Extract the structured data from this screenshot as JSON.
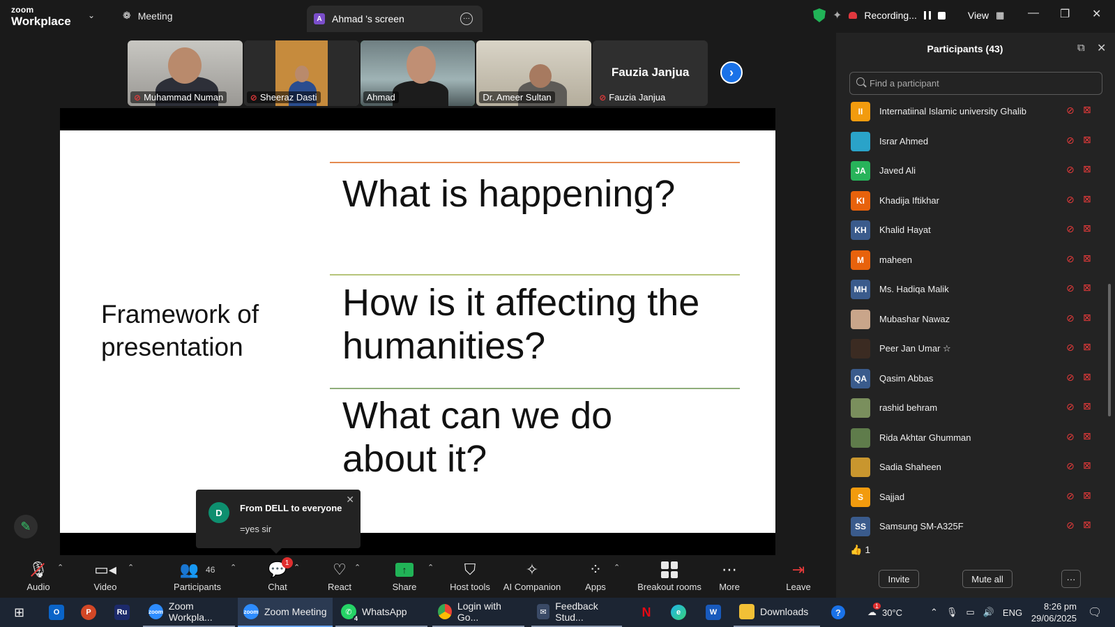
{
  "window": {
    "brand_top": "zoom",
    "brand_bottom": "Workplace",
    "meeting_tab": "Meeting",
    "screen_tab": "Ahmad 's screen",
    "screen_tab_avatar": "A",
    "recording_label": "Recording...",
    "view_label": "View"
  },
  "gallery": [
    {
      "name": "Muhammad Numan",
      "muted": true,
      "active": false
    },
    {
      "name": "Sheeraz Dasti",
      "muted": true,
      "active": false
    },
    {
      "name": "Ahmad",
      "muted": false,
      "active": true
    },
    {
      "name": "Dr. Ameer Sultan",
      "muted": false,
      "active": false
    },
    {
      "name": "Fauzia Janjua",
      "muted": true,
      "active": false,
      "big_label": "Fauzia Janjua"
    }
  ],
  "slide": {
    "left_title_line1": "Framework of",
    "left_title_line2": "presentation",
    "q1": "What is happening?",
    "q2_line1": "How is it affecting the",
    "q2_line2": "humanities?",
    "q3_line1": "What can we do",
    "q3_line2": "about it?",
    "line_colors": [
      "#e48a4f",
      "#b6c47a",
      "#8fae7a"
    ]
  },
  "chat_toast": {
    "avatar": "D",
    "from": "From DELL to everyone",
    "message": "=yes sir"
  },
  "toolbar": {
    "audio": "Audio",
    "video": "Video",
    "participants": "Participants",
    "participants_count": "46",
    "chat": "Chat",
    "chat_badge": "1",
    "react": "React",
    "share": "Share",
    "host_tools": "Host tools",
    "ai_companion": "AI Companion",
    "apps": "Apps",
    "breakout_rooms": "Breakout rooms",
    "more": "More",
    "leave": "Leave"
  },
  "participants_panel": {
    "title": "Participants (43)",
    "search_placeholder": "Find a participant",
    "items": [
      {
        "name": "Internatiinal Islamic university Ghalib",
        "initials": "II",
        "color": "#f29b0e"
      },
      {
        "name": "Israr Ahmed",
        "initials": "",
        "color": "#2aa3c9"
      },
      {
        "name": "Javed Ali",
        "initials": "JA",
        "color": "#27b35a"
      },
      {
        "name": "Khadija Iftikhar",
        "initials": "KI",
        "color": "#e8620c"
      },
      {
        "name": "Khalid Hayat",
        "initials": "KH",
        "color": "#3a5b8c"
      },
      {
        "name": "maheen",
        "initials": "M",
        "color": "#e8620c"
      },
      {
        "name": "Ms. Hadiqa Malik",
        "initials": "MH",
        "color": "#3a5b8c"
      },
      {
        "name": "Mubashar Nawaz",
        "initials": "",
        "color": "#c9a58a"
      },
      {
        "name": "Peer Jan Umar ☆",
        "initials": "",
        "color": "#3b2b22"
      },
      {
        "name": "Qasim Abbas",
        "initials": "QA",
        "color": "#3a5b8c"
      },
      {
        "name": "rashid behram",
        "initials": "",
        "color": "#7a8f5d"
      },
      {
        "name": "Rida Akhtar Ghumman",
        "initials": "",
        "color": "#5f7c4b"
      },
      {
        "name": "Sadia Shaheen",
        "initials": "",
        "color": "#c9962e"
      },
      {
        "name": "Sajjad",
        "initials": "S",
        "color": "#f29b0e"
      },
      {
        "name": "Samsung SM-A325F",
        "initials": "SS",
        "color": "#3a5b8c"
      }
    ],
    "reaction": "👍 1",
    "invite": "Invite",
    "mute_all": "Mute all",
    "more": "···"
  },
  "taskbar": {
    "apps": [
      {
        "label": "Zoom Workpla...",
        "icon": "zoom"
      },
      {
        "label": "Zoom Meeting",
        "icon": "zoom"
      },
      {
        "label": "WhatsApp",
        "icon": "whatsapp",
        "badge": "4"
      },
      {
        "label": "Login with Go...",
        "icon": "chrome"
      },
      {
        "label": "Feedback Stud...",
        "icon": "feedback"
      },
      {
        "label": "Downloads",
        "icon": "folder"
      }
    ],
    "icon_ru": "Ru",
    "weather": "30°C",
    "weather_badge": "1",
    "lang": "ENG",
    "time": "8:26 pm",
    "date": "29/06/2025"
  }
}
